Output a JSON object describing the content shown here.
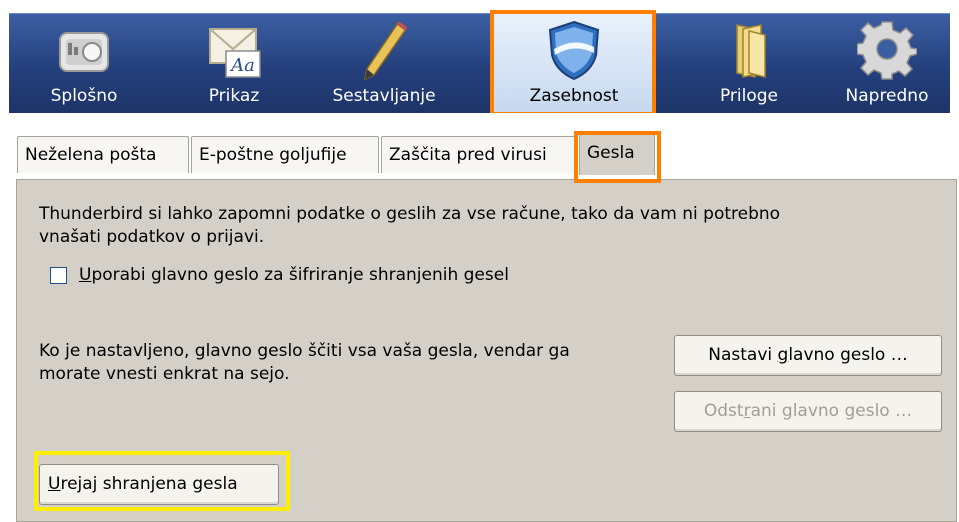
{
  "toolbar": {
    "panes": [
      {
        "label": "Splošno",
        "icon": "general-switch-icon"
      },
      {
        "label": "Prikaz",
        "icon": "display-envelope-icon"
      },
      {
        "label": "Sestavljanje",
        "icon": "compose-pencil-icon"
      },
      {
        "label": "Zasebnost",
        "icon": "privacy-shield-icon"
      },
      {
        "label": "Priloge",
        "icon": "attachments-folder-icon"
      },
      {
        "label": "Napredno",
        "icon": "advanced-gear-icon"
      }
    ],
    "selected": "Zasebnost"
  },
  "tabs": [
    {
      "label": "Neželena pošta"
    },
    {
      "label": "E-poštne goljufije"
    },
    {
      "label": "Zaščita pred virusi"
    },
    {
      "label": "Gesla"
    }
  ],
  "active_tab": "Gesla",
  "passwords": {
    "intro_line1": "Thunderbird si lahko zapomni podatke o geslih za vse račune, tako da vam ni potrebno",
    "intro_line2": "vnašati podatkov o prijavi.",
    "master_checkbox_prefix": "",
    "master_checkbox_accel": "U",
    "master_checkbox_rest": "porabi glavno geslo za šifriranje shranjenih gesel",
    "master_checked": false,
    "master_info_line1": "Ko je nastavljeno, glavno geslo ščiti vsa vaša gesla, vendar ga",
    "master_info_line2": "morate vnesti enkrat na sejo.",
    "set_master_pre": "Nastavi ",
    "set_master_accel": "g",
    "set_master_post": "lavno geslo …",
    "remove_master_pre": "Odst",
    "remove_master_accel": "r",
    "remove_master_post": "ani glavno geslo …",
    "saved_pre": "",
    "saved_accel": "U",
    "saved_post": "rejaj shranjena gesla"
  },
  "highlight_colors": {
    "orange": "#ff7f00",
    "yellow": "#ffee00"
  }
}
